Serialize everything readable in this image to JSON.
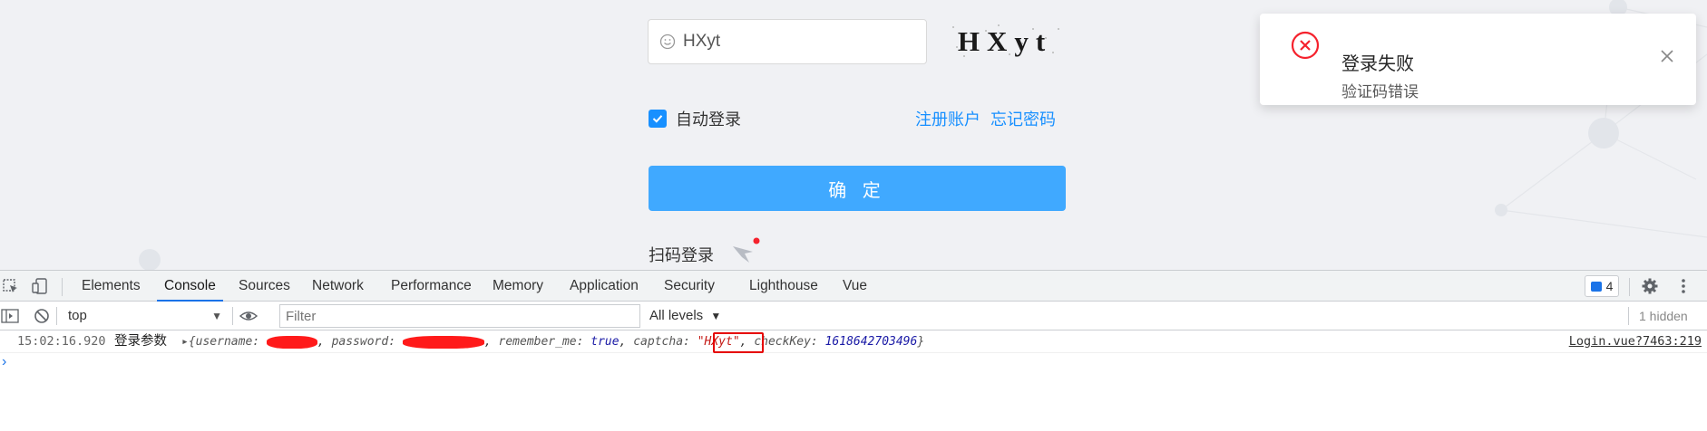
{
  "login": {
    "captcha_value": "HXyt",
    "captcha_image_text": "HXyt",
    "remember_label": "自动登录",
    "remember_checked": true,
    "register_link": "注册账户",
    "forgot_link": "忘记密码",
    "submit_label": "确 定",
    "qr_login_label": "扫码登录"
  },
  "notification": {
    "title": "登录失败",
    "description": "验证码错误",
    "status_color": "#f5222d"
  },
  "devtools": {
    "tabs": [
      "Elements",
      "Console",
      "Sources",
      "Network",
      "Performance",
      "Memory",
      "Application",
      "Security",
      "Lighthouse",
      "Vue"
    ],
    "active_tab": "Console",
    "message_count": "4",
    "context": "top",
    "filter_placeholder": "Filter",
    "levels": "All levels",
    "hidden": "1 hidden",
    "log": {
      "timestamp": "15:02:16.920",
      "label": "登录参数",
      "object_open": "{username: ",
      "k_password": "password: ",
      "k_remember": "remember_me: ",
      "v_remember": "true",
      "k_captcha": "captcha: ",
      "v_captcha": "\"HXyt\"",
      "k_checkkey": "checkKey: ",
      "v_checkkey": "1618642703496",
      "object_close": "}",
      "source": "Login.vue?7463:219"
    },
    "prompt": "›",
    "accent_color": "#1a73e8"
  }
}
